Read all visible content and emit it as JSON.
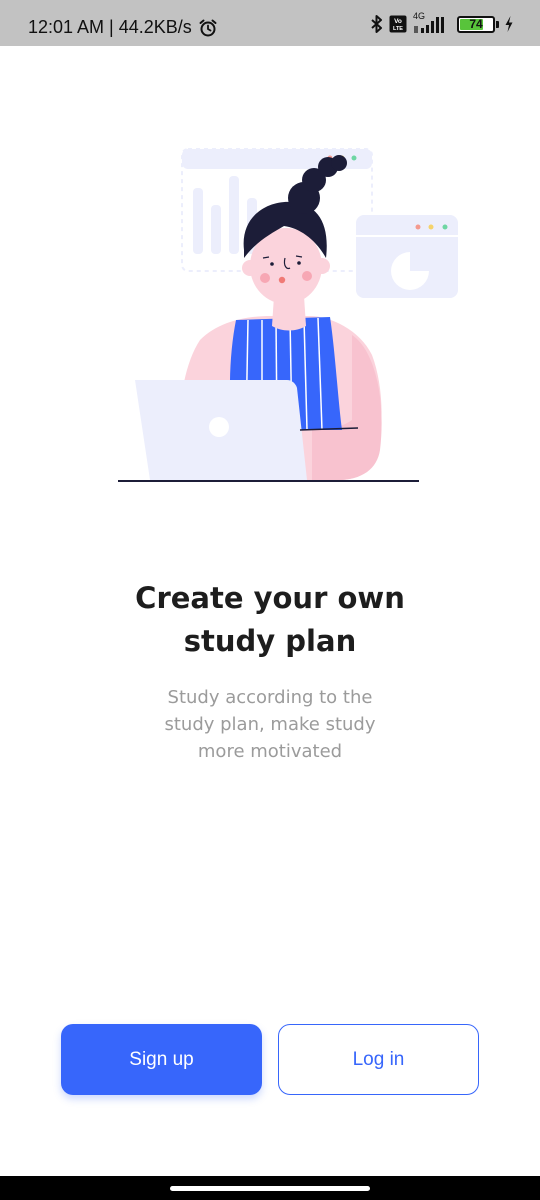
{
  "status_bar": {
    "time": "12:01 AM | 44.2KB/s",
    "network_label": "4G",
    "volte_label": "Vo LTE",
    "battery_level": "74",
    "battery_fraction": 0.74,
    "icons": [
      "alarm-icon",
      "bluetooth-icon",
      "volte-icon",
      "signal-icon",
      "battery-icon",
      "charging-icon"
    ]
  },
  "onboarding": {
    "illustration": "girl-at-laptop-illustration",
    "title": "Create your own study plan",
    "subtitle": "Study according to the study plan, make study more motivated"
  },
  "actions": {
    "signup_label": "Sign up",
    "login_label": "Log in"
  },
  "colors": {
    "primary": "#3766fb",
    "title": "#1d1d1d",
    "subtitle": "#9b9b9b",
    "status_bar_bg": "#c2c2c2",
    "battery_green": "#58c43b",
    "illustration_lavender": "#eceefc",
    "illustration_pink": "#fbd3dc",
    "illustration_hair": "#1c1d38"
  }
}
